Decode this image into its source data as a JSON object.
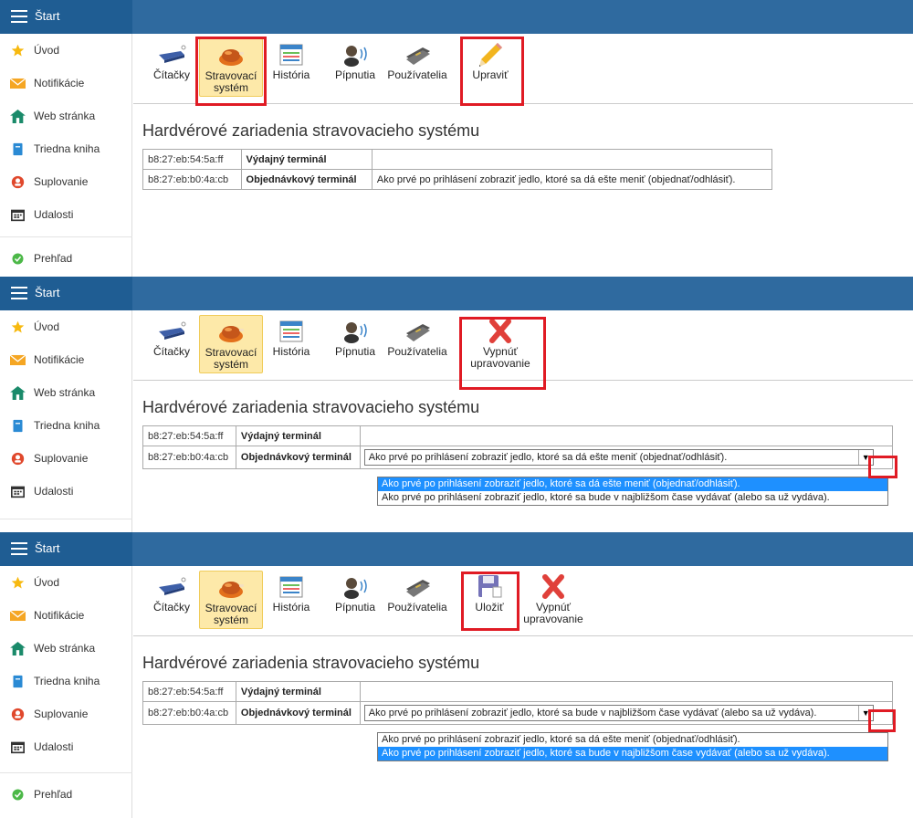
{
  "app_title": "Štart",
  "sidebar": {
    "items": [
      {
        "label": "Úvod",
        "icon": "star-icon"
      },
      {
        "label": "Notifikácie",
        "icon": "envelope-icon"
      },
      {
        "label": "Web stránka",
        "icon": "home-icon"
      },
      {
        "label": "Triedna kniha",
        "icon": "book-icon"
      },
      {
        "label": "Suplovanie",
        "icon": "substitute-icon"
      },
      {
        "label": "Udalosti",
        "icon": "calendar-icon"
      }
    ],
    "overview": {
      "label": "Prehľad",
      "icon": "check-circle-icon"
    }
  },
  "toolbar": {
    "readers": "Čítačky",
    "dining_line1": "Stravovací",
    "dining_line2": "systém",
    "history": "História",
    "pins": "Pípnutia",
    "users": "Používatelia",
    "edit": "Upraviť",
    "disable_line1": "Vypnúť",
    "disable_line2": "upravovanie",
    "save": "Uložiť"
  },
  "heading": "Hardvérové zariadenia stravovacieho systému",
  "devices": [
    {
      "mac": "b8:27:eb:54:5a:ff",
      "name": "Výdajný terminál",
      "setting": ""
    },
    {
      "mac": "b8:27:eb:b0:4a:cb",
      "name": "Objednávkový terminál",
      "setting": "Ako prvé po prihlásení zobraziť jedlo, ktoré sa dá ešte meniť (objednať/odhlásiť)."
    }
  ],
  "options": [
    "Ako prvé po prihlásení zobraziť jedlo, ktoré sa dá ešte meniť (objednať/odhlásiť).",
    "Ako prvé po prihlásení zobraziť jedlo, ktoré sa bude v najbližšom čase vydávať (alebo sa už vydáva)."
  ],
  "dropdown_arrow": "▼",
  "colors": {
    "topbar": "#2f6a9f",
    "highlight": "#e01b24",
    "active_button": "#fde9a9",
    "selected_option": "#1e90ff"
  }
}
